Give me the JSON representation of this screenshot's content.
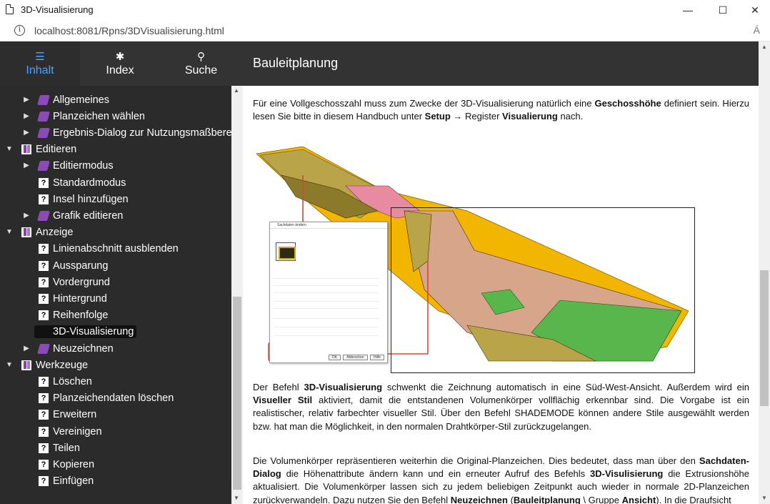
{
  "window": {
    "title": "3D-Visualisierung",
    "controls": {
      "minimize": "—",
      "maximize": "☐",
      "close": "✕"
    }
  },
  "address_bar": {
    "url": "localhost:8081/Rpns/3DVisualisierung.html",
    "info_glyph": "i",
    "read_aloud_glyph": "Á"
  },
  "nav": {
    "tabs": [
      {
        "label": "Inhalt",
        "icon": "list-icon",
        "glyph": "☰",
        "active": true
      },
      {
        "label": "Index",
        "icon": "asterisk-icon",
        "glyph": "✱",
        "active": false
      },
      {
        "label": "Suche",
        "icon": "search-icon",
        "glyph": "⚲",
        "active": false
      }
    ],
    "page_heading": "Bauleitplanung"
  },
  "sidebar": {
    "items": [
      {
        "label": "Allgemeines",
        "level": 2,
        "icon": "topic-book-icon",
        "expandable": true,
        "expanded": false
      },
      {
        "label": "Planzeichen wählen",
        "level": 2,
        "icon": "topic-book-icon",
        "expandable": true,
        "expanded": false
      },
      {
        "label": "Ergebnis-Dialog zur Nutzungsmaßberechnung",
        "level": 2,
        "icon": "topic-book-icon",
        "expandable": true,
        "expanded": false
      },
      {
        "label": "Editieren",
        "level": 1,
        "icon": "open-book-icon",
        "expandable": true,
        "expanded": true
      },
      {
        "label": "Editiermodus",
        "level": 2,
        "icon": "topic-book-icon",
        "expandable": true,
        "expanded": false
      },
      {
        "label": "Standardmodus",
        "level": 2,
        "icon": "help-page-icon",
        "expandable": false
      },
      {
        "label": "Insel hinzufügen",
        "level": 2,
        "icon": "help-page-icon",
        "expandable": false
      },
      {
        "label": "Grafik editieren",
        "level": 2,
        "icon": "topic-book-icon",
        "expandable": true,
        "expanded": false
      },
      {
        "label": "Anzeige",
        "level": 1,
        "icon": "open-book-icon",
        "expandable": true,
        "expanded": true
      },
      {
        "label": "Linienabschnitt ausblenden",
        "level": 2,
        "icon": "help-page-icon",
        "expandable": false
      },
      {
        "label": "Aussparung",
        "level": 2,
        "icon": "help-page-icon",
        "expandable": false
      },
      {
        "label": "Vordergrund",
        "level": 2,
        "icon": "help-page-icon",
        "expandable": false
      },
      {
        "label": "Hintergrund",
        "level": 2,
        "icon": "help-page-icon",
        "expandable": false
      },
      {
        "label": "Reihenfolge",
        "level": 2,
        "icon": "help-page-icon",
        "expandable": false
      },
      {
        "label": "3D-Visualisierung",
        "level": 2,
        "icon": "help-page-icon",
        "expandable": false,
        "selected": true
      },
      {
        "label": "Neuzeichnen",
        "level": 2,
        "icon": "topic-book-icon",
        "expandable": true,
        "expanded": false
      },
      {
        "label": "Werkzeuge",
        "level": 1,
        "icon": "open-book-icon",
        "expandable": true,
        "expanded": true
      },
      {
        "label": "Löschen",
        "level": 2,
        "icon": "help-page-icon",
        "expandable": false
      },
      {
        "label": "Planzeichendaten löschen",
        "level": 2,
        "icon": "help-page-icon",
        "expandable": false
      },
      {
        "label": "Erweitern",
        "level": 2,
        "icon": "help-page-icon",
        "expandable": false
      },
      {
        "label": "Vereinigen",
        "level": 2,
        "icon": "help-page-icon",
        "expandable": false
      },
      {
        "label": "Teilen",
        "level": 2,
        "icon": "help-page-icon",
        "expandable": false
      },
      {
        "label": "Kopieren",
        "level": 2,
        "icon": "help-page-icon",
        "expandable": false
      },
      {
        "label": "Einfügen",
        "level": 2,
        "icon": "help-page-icon",
        "expandable": false
      }
    ]
  },
  "content": {
    "p1": [
      {
        "t": "Für eine Vollgeschosszahl muss zum Zwecke der 3D-Visualisierung natürlich eine "
      },
      {
        "t": "Geschosshöhe",
        "b": true
      },
      {
        "t": " definiert sein. Hierzu lesen Sie bitte in diesem Handbuch unter "
      },
      {
        "t": "Setup",
        "b": true
      },
      {
        "t": " → Register "
      },
      {
        "t": "Visualierung",
        "b": true
      },
      {
        "t": " nach."
      }
    ],
    "p2": [
      {
        "t": "Der Befehl "
      },
      {
        "t": "3D-Visualisierung",
        "b": true
      },
      {
        "t": " schwenkt die Zeichnung automatisch in eine Süd-West-Ansicht. Außerdem wird ein "
      },
      {
        "t": "Visueller Stil",
        "b": true
      },
      {
        "t": " aktiviert, damit die entstandenen Volumenkörper vollflächig erkennbar sind. Die Vorgabe ist ein realistischer, relativ farbechter visueller Stil. Über den Befehl SHADEMODE können andere Stile ausgewählt werden bzw. hat man die Möglichkeit, in den normalen Drahtkörper-Stil zurückzugelangen."
      }
    ],
    "p3": [
      {
        "t": "Die Volumenkörper repräsentieren weiterhin die Original-Planzeichen. Dies bedeutet, dass man über den "
      },
      {
        "t": "Sachdaten-Dialog",
        "b": true
      },
      {
        "t": " die Höhenattribute ändern kann und ein erneuter Aufruf des Befehls "
      },
      {
        "t": "3D-Visulisierung",
        "b": true
      },
      {
        "t": " die Extrusionshöhe aktualisiert. Die Volumenkörper lassen sich zu jedem beliebigen Zeitpunkt auch wieder in normale 2D-Planzeichen zurückverwandeln. Dazu nutzen Sie den Befehl "
      },
      {
        "t": "Neuzeichnen",
        "b": true
      },
      {
        "t": " ("
      },
      {
        "t": "Bauleitplanung",
        "b": true
      },
      {
        "t": " \\ Gruppe "
      },
      {
        "t": "Ansicht",
        "b": true
      },
      {
        "t": "). In die Draufsicht"
      }
    ],
    "figure": {
      "dialog_title": "Sachdaten ändern",
      "dialog_buttons": [
        "OK",
        "Abbrechen",
        "Hilfe"
      ],
      "colors": {
        "yellow": "#f2b600",
        "olive": "#b9a44a",
        "salmon": "#d7a68a",
        "green": "#58b64c",
        "pink": "#e88aa0",
        "red_line": "#d9453a"
      }
    }
  }
}
